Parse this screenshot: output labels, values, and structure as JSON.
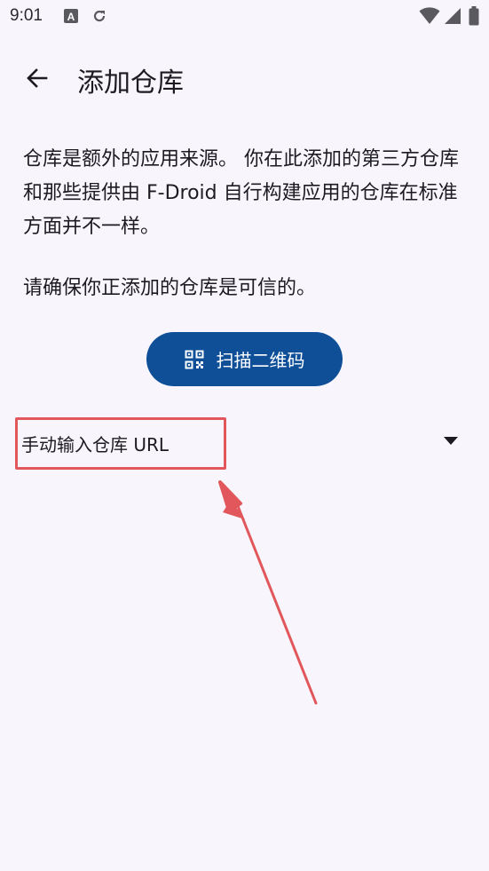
{
  "status_bar": {
    "time": "9:01",
    "left_icons": [
      "font-a-icon",
      "sync-icon"
    ],
    "right_icons": [
      "wifi-icon",
      "cellular-signal-icon",
      "battery-icon"
    ]
  },
  "app_bar": {
    "back_icon": "arrow-back-icon",
    "title": "添加仓库"
  },
  "content": {
    "intro": "仓库是额外的应用来源。 你在此添加的第三方仓库和那些提供由 F-Droid 自行构建应用的仓库在标准方面并不一样。",
    "trust_notice": "请确保你正添加的仓库是可信的。",
    "scan_button": {
      "icon": "qr-code-icon",
      "label": "扫描二维码"
    },
    "manual_entry": {
      "label": "手动输入仓库 URL",
      "expand_icon": "arrow-drop-down-icon"
    }
  },
  "colors": {
    "background": "#F8F6FC",
    "primary_button": "#0E4F98",
    "annotation": "#E1575B",
    "text": "#1C1B1F"
  }
}
